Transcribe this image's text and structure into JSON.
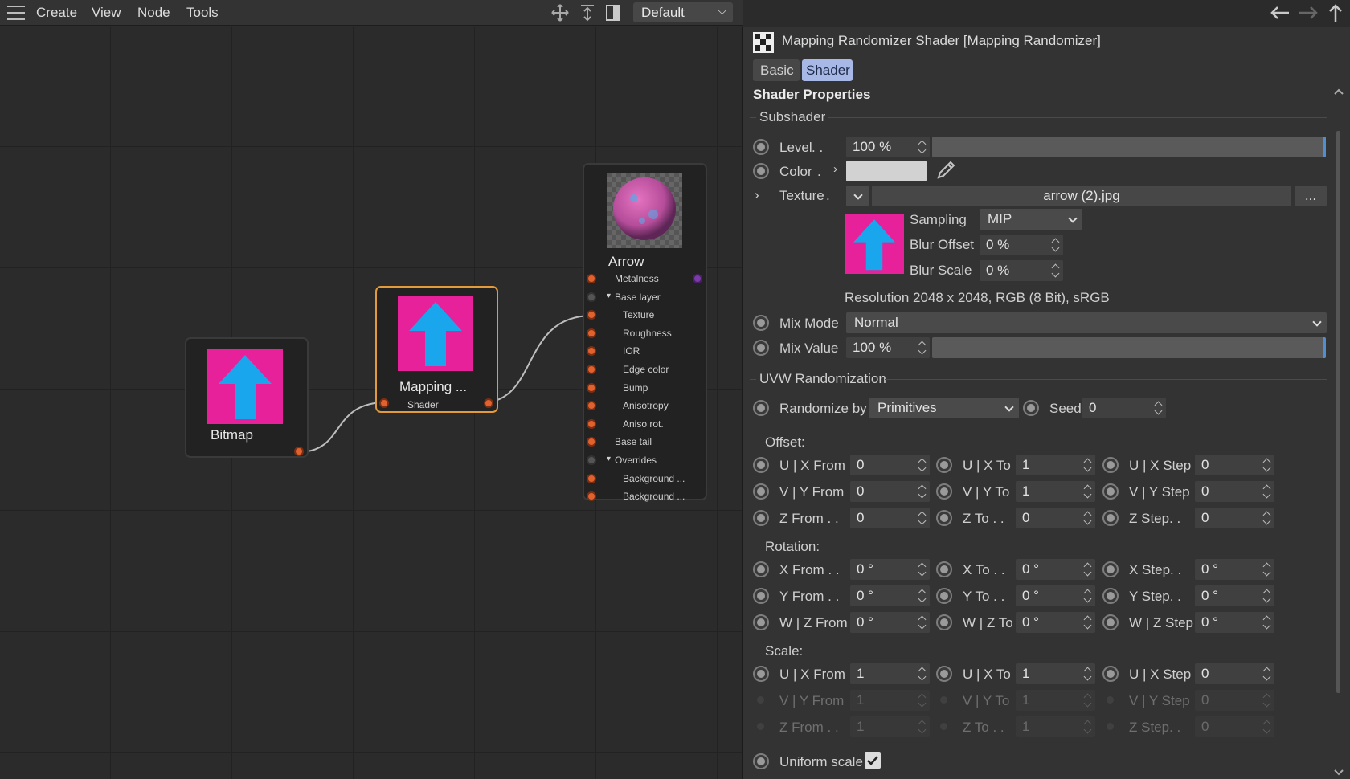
{
  "menubar": {
    "items": [
      "Create",
      "View",
      "Node",
      "Tools"
    ],
    "preset": "Default"
  },
  "nodes": {
    "bitmap": {
      "title": "Bitmap"
    },
    "mapping": {
      "title": "Mapping ...",
      "port_label": "Shader"
    },
    "material": {
      "title": "Arrow",
      "ports": [
        "Metalness",
        "Base layer",
        "Texture",
        "Roughness",
        "IOR",
        "Edge color",
        "Bump",
        "Anisotropy",
        "Aniso rot.",
        "Base tail",
        "Overrides",
        "Background ...",
        "Background ..."
      ]
    }
  },
  "panel": {
    "title": "Mapping Randomizer Shader [Mapping Randomizer]",
    "tabs": [
      "Basic",
      "Shader"
    ],
    "active_tab": "Shader",
    "section": "Shader Properties",
    "subshader": {
      "group": "Subshader",
      "level_label": "Level",
      "level_value": "100 %",
      "color_label": "Color",
      "color_swatch": "#d2d2d2",
      "texture_label": "Texture",
      "texture_file": "arrow (2).jpg",
      "browse": "...",
      "sampling_label": "Sampling",
      "sampling_value": "MIP",
      "blur_offset_label": "Blur Offset",
      "blur_offset_value": "0 %",
      "blur_scale_label": "Blur Scale",
      "blur_scale_value": "0 %",
      "resolution": "Resolution 2048 x 2048, RGB (8 Bit), sRGB",
      "mix_mode_label": "Mix Mode",
      "mix_mode_value": "Normal",
      "mix_value_label": "Mix Value",
      "mix_value": "100 %"
    },
    "uvw": {
      "group": "UVW Randomization",
      "randomize_label": "Randomize by",
      "randomize_value": "Primitives",
      "seed_label": "Seed",
      "seed_value": "0",
      "offset_label": "Offset:",
      "rotation_label": "Rotation:",
      "scale_label": "Scale:",
      "offset_rows": [
        [
          {
            "label": "U | X From",
            "value": "0"
          },
          {
            "label": "U | X To",
            "value": "1"
          },
          {
            "label": "U | X Step",
            "value": "0"
          }
        ],
        [
          {
            "label": "V | Y From",
            "value": "0"
          },
          {
            "label": "V | Y To",
            "value": "1"
          },
          {
            "label": "V | Y Step",
            "value": "0"
          }
        ],
        [
          {
            "label": "Z From . .",
            "value": "0"
          },
          {
            "label": "Z To . .",
            "value": "0"
          },
          {
            "label": "Z Step. .",
            "value": "0"
          }
        ]
      ],
      "rotation_rows": [
        [
          {
            "label": "X From . .",
            "value": "0 °"
          },
          {
            "label": "X To . .",
            "value": "0 °"
          },
          {
            "label": "X Step. .",
            "value": "0 °"
          }
        ],
        [
          {
            "label": "Y From . .",
            "value": "0 °"
          },
          {
            "label": "Y To . .",
            "value": "0 °"
          },
          {
            "label": "Y Step. .",
            "value": "0 °"
          }
        ],
        [
          {
            "label": "W | Z From",
            "value": "0 °"
          },
          {
            "label": "W | Z To",
            "value": "0 °"
          },
          {
            "label": "W | Z Step",
            "value": "0 °"
          }
        ]
      ],
      "scale_rows": [
        [
          {
            "label": "U | X From",
            "value": "1"
          },
          {
            "label": "U | X To",
            "value": "1"
          },
          {
            "label": "U | X Step",
            "value": "0"
          }
        ],
        [
          {
            "label": "V | Y From",
            "value": "1"
          },
          {
            "label": "V | Y To",
            "value": "1"
          },
          {
            "label": "V | Y Step",
            "value": "0"
          }
        ],
        [
          {
            "label": "Z From . .",
            "value": "1"
          },
          {
            "label": "Z To . .",
            "value": "1"
          },
          {
            "label": "Z Step. .",
            "value": "0"
          }
        ]
      ],
      "uniform_scale_label": "Uniform scale",
      "uniform_scale_checked": true
    }
  },
  "colors": {
    "accent": "#4f8fd0",
    "port": "#e1622f",
    "selected_node": "#e29a3a",
    "magenta": "#e6219a",
    "arrow": "#19a6ec"
  }
}
